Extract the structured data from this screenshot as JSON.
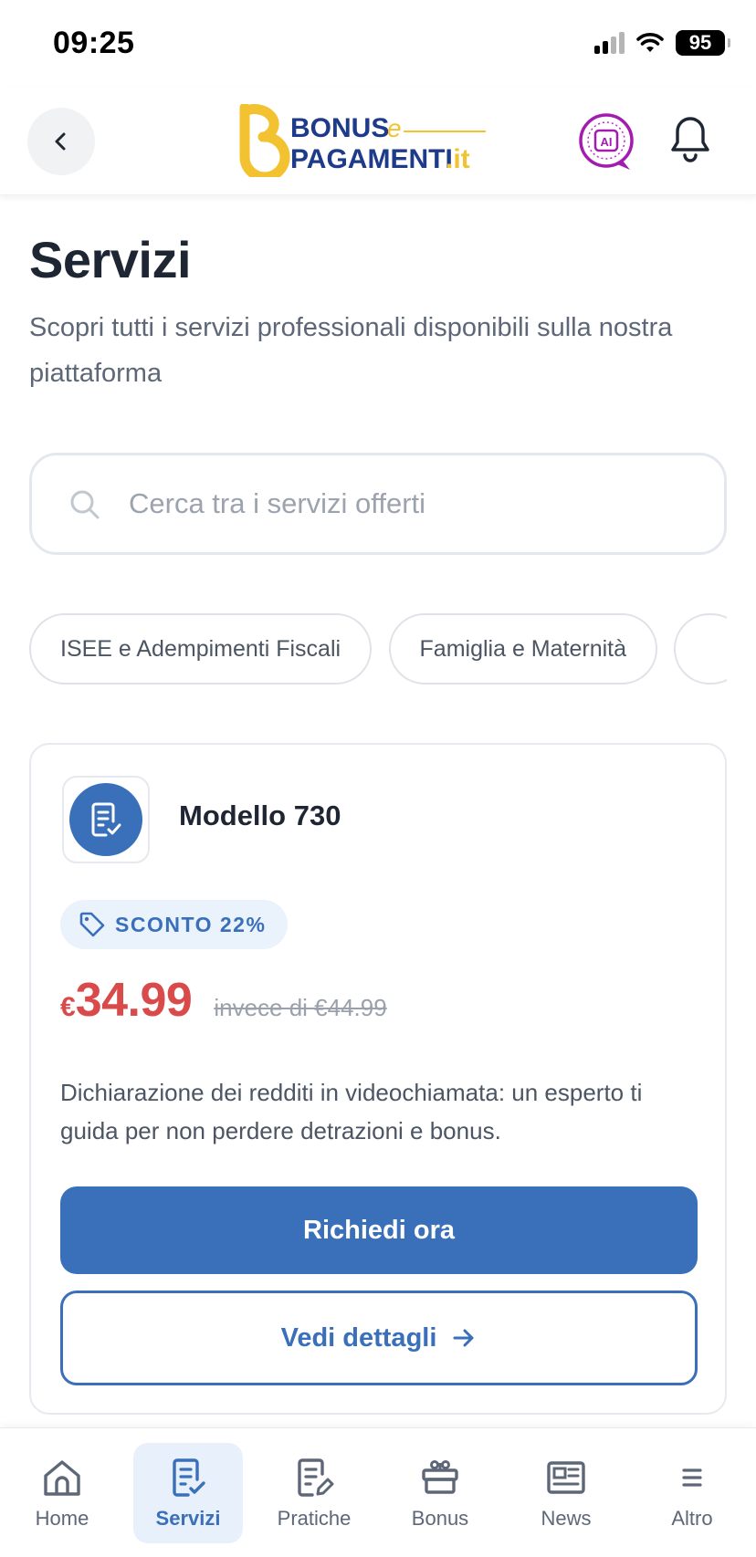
{
  "status_bar": {
    "time": "09:25",
    "battery": "95"
  },
  "header": {
    "logo_word1": "BONUS",
    "logo_connector": "e",
    "logo_word2": "PAGAMENTI",
    "logo_tld": ".it",
    "ai_badge": "AI"
  },
  "page": {
    "title": "Servizi",
    "subtitle": "Scopri tutti i servizi professionali disponibili sulla nostra piattaforma"
  },
  "search": {
    "placeholder": "Cerca tra i servizi offerti",
    "value": ""
  },
  "categories": [
    {
      "label": "ISEE e Adempimenti Fiscali"
    },
    {
      "label": "Famiglia e Maternità"
    },
    {
      "label": ""
    }
  ],
  "service_card": {
    "title": "Modello 730",
    "discount": "SCONTO 22%",
    "price_currency": "€",
    "price": "34.99",
    "old_price": "invece di €44.99",
    "description": "Dichiarazione dei redditi in videochiamata: un esperto ti guida per non perdere detrazioni e bonus.",
    "primary_button": "Richiedi ora",
    "secondary_button": "Vedi dettagli"
  },
  "bottom_nav": [
    {
      "label": "Home",
      "icon": "home-icon",
      "active": false
    },
    {
      "label": "Servizi",
      "icon": "document-check-icon",
      "active": true
    },
    {
      "label": "Pratiche",
      "icon": "document-edit-icon",
      "active": false
    },
    {
      "label": "Bonus",
      "icon": "gift-icon",
      "active": false
    },
    {
      "label": "News",
      "icon": "newspaper-icon",
      "active": false
    },
    {
      "label": "Altro",
      "icon": "menu-icon",
      "active": false
    }
  ],
  "colors": {
    "primary": "#3a6fb9",
    "price": "#d94b4b",
    "logo_yellow": "#f2c230",
    "logo_blue": "#1e3a8a",
    "ai_purple": "#a21caf"
  }
}
